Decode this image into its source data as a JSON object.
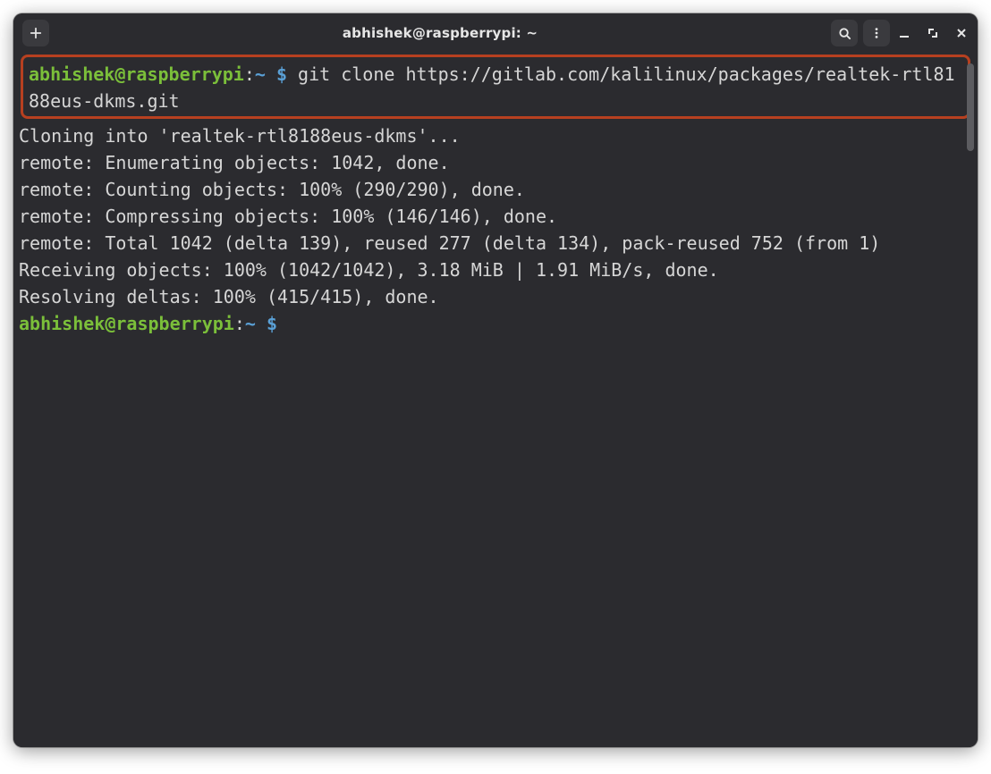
{
  "titlebar": {
    "title": "abhishek@raspberrypi: ~"
  },
  "prompt1": {
    "user": "abhishek@raspberrypi",
    "colon": ":",
    "path": "~",
    "dollar": " $ ",
    "command": "git clone https://gitlab.com/kalilinux/packages/realtek-rtl8188eus-dkms.git"
  },
  "output": {
    "l1": "Cloning into 'realtek-rtl8188eus-dkms'...",
    "l2": "remote: Enumerating objects: 1042, done.",
    "l3": "remote: Counting objects: 100% (290/290), done.",
    "l4": "remote: Compressing objects: 100% (146/146), done.",
    "l5": "remote: Total 1042 (delta 139), reused 277 (delta 134), pack-reused 752 (from 1)",
    "l6": "Receiving objects: 100% (1042/1042), 3.18 MiB | 1.91 MiB/s, done.",
    "l7": "Resolving deltas: 100% (415/415), done."
  },
  "prompt2": {
    "user": "abhishek@raspberrypi",
    "colon": ":",
    "path": "~",
    "dollar": " $ "
  },
  "colors": {
    "highlight_border": "#b74020",
    "prompt_user": "#7bbf3a",
    "prompt_path": "#5aa0d6",
    "bg": "#2b2b2f",
    "fg": "#d6d6d6"
  }
}
